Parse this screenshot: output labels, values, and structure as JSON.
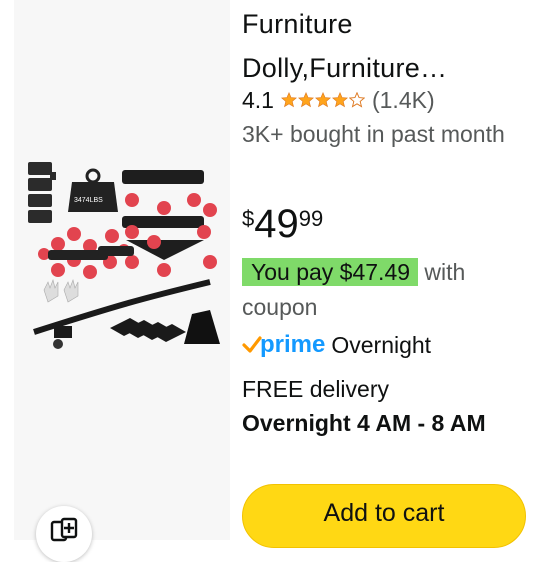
{
  "product": {
    "title": "Furniture Dolly,Furniture…",
    "rating": "4.1",
    "rating_value": 4.1,
    "review_count": "(1.4K)",
    "bought_text": "3K+ bought in past month",
    "price": {
      "symbol": "$",
      "whole": "49",
      "fraction": "99"
    },
    "coupon": {
      "you_pay": "You pay $47.49",
      "suffix": " with coupon"
    },
    "prime": {
      "logo_text": "prime",
      "delivery_speed": "Overnight"
    },
    "delivery": {
      "line1": "FREE delivery",
      "line2": "Overnight 4 AM - 8 AM"
    },
    "add_to_cart_label": "Add to cart",
    "image_weight_label": "3474LBS"
  },
  "colors": {
    "star": "#ffa41c",
    "coupon_bg": "#7fda69",
    "prime_blue": "#1399ff",
    "prime_check": "#ff9900",
    "cart_button": "#ffd814"
  },
  "icons": [
    "star-icon",
    "prime-check-icon",
    "compare-icon"
  ]
}
